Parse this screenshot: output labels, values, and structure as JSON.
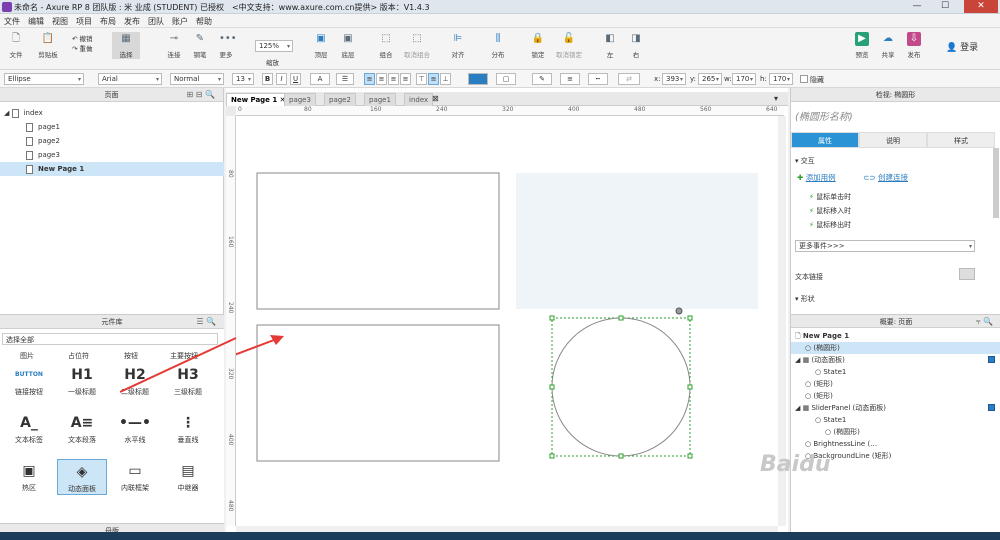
{
  "window": {
    "title": "未命名 - Axure RP 8 团队版 : 米 业成 (STUDENT) 已授权　<中文支持：www.axure.com.cn提供> 版本：V1.4.3",
    "min": "—",
    "max": "☐",
    "close": "✕"
  },
  "menu": [
    "文件",
    "编辑",
    "视图",
    "项目",
    "布局",
    "发布",
    "团队",
    "账户",
    "帮助"
  ],
  "toolbar": {
    "file": "文件",
    "clipboard": "剪贴板",
    "undo": "撤销",
    "redo": "重做",
    "select": "选择",
    "connect": "连接",
    "pen": "钢笔",
    "more": "更多",
    "zoom_value": "125%",
    "zoom_label": "缩放",
    "top": "顶层",
    "bottom": "底层",
    "group": "组合",
    "ungroup": "取消组合",
    "align": "对齐",
    "distribute": "分布",
    "lock": "锁定",
    "unlock": "取消锁定",
    "left": "左",
    "right": "右",
    "preview": "预览",
    "share": "共享",
    "publish": "发布",
    "login": "登录"
  },
  "format": {
    "widget_style": "Ellipse",
    "font": "Arial",
    "weight": "Normal",
    "size": "13",
    "bold": "B",
    "italic": "I",
    "underline": "U",
    "x_label": "x:",
    "x": "393",
    "y_label": "y:",
    "y": "265",
    "w_label": "w:",
    "w": "170",
    "h_label": "h:",
    "h": "170",
    "hidden": "隐藏"
  },
  "pages_panel": {
    "title": "页面",
    "items": [
      "index",
      "page1",
      "page2",
      "page3",
      "New Page 1"
    ]
  },
  "library": {
    "title": "元件库",
    "select_all": "选择全部",
    "cats": [
      "图片",
      "占位符",
      "按钮",
      "主要按钮"
    ],
    "items": [
      {
        "glyph": "BUTTON",
        "label": "链接按钮"
      },
      {
        "glyph": "H1",
        "label": "一级标题"
      },
      {
        "glyph": "H2",
        "label": "二级标题"
      },
      {
        "glyph": "H3",
        "label": "三级标题"
      },
      {
        "glyph": "A_",
        "label": "文本标签"
      },
      {
        "glyph": "A≡",
        "label": "文本段落"
      },
      {
        "glyph": "•—•",
        "label": "水平线"
      },
      {
        "glyph": "⋮",
        "label": "垂直线"
      },
      {
        "glyph": "▣",
        "label": "热区"
      },
      {
        "glyph": "◈",
        "label": "动态面板"
      },
      {
        "glyph": "▭",
        "label": "内联框架"
      },
      {
        "glyph": "▤",
        "label": "中继器"
      }
    ],
    "master": "母版"
  },
  "tabs": [
    "New Page 1",
    "page3",
    "page2",
    "page1",
    "index"
  ],
  "ruler_h": [
    "0",
    "80",
    "160",
    "240",
    "320",
    "400",
    "480",
    "560",
    "640"
  ],
  "ruler_v": [
    "80",
    "160",
    "240",
    "320",
    "400",
    "480"
  ],
  "inspector": {
    "title": "检视: 椭圆形",
    "name_placeholder": "(椭圆形名称)",
    "tabs": [
      "属性",
      "说明",
      "样式"
    ],
    "interaction": "交互",
    "add_case": "添加用例",
    "create_link": "创建连接",
    "events": [
      "鼠标单击时",
      "鼠标移入时",
      "鼠标移出时"
    ],
    "more_events": "更多事件>>>",
    "text_link": "文本链接",
    "shape": "形状"
  },
  "outline": {
    "title": "概要: 页面",
    "rows": [
      {
        "label": "New Page 1",
        "level": 0
      },
      {
        "label": "(椭圆形)",
        "level": 1,
        "sel": true
      },
      {
        "label": "(动态面板)",
        "level": 0,
        "chk": true
      },
      {
        "label": "State1",
        "level": 2
      },
      {
        "label": "(矩形)",
        "level": 1
      },
      {
        "label": "(矩形)",
        "level": 1
      },
      {
        "label": "SliderPanel (动态面板)",
        "level": 0,
        "chk": true
      },
      {
        "label": "State1",
        "level": 2
      },
      {
        "label": "(椭圆形)",
        "level": 3
      },
      {
        "label": "BrightnessLine (…",
        "level": 1
      },
      {
        "label": "BackgroundLine (矩形)",
        "level": 1
      }
    ]
  },
  "watermark": "Baidu"
}
